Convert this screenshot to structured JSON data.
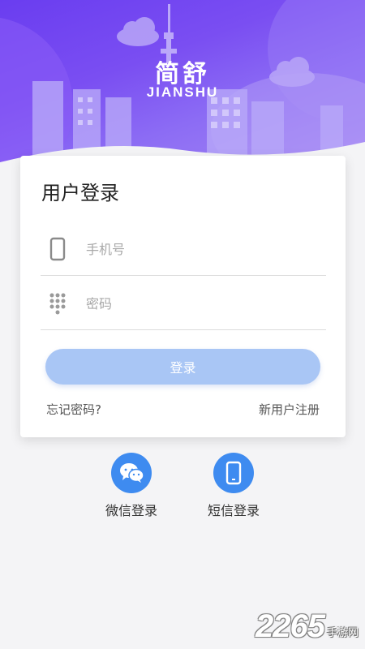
{
  "brand": {
    "title": "简舒",
    "subtitle": "JIANSHU"
  },
  "login_card": {
    "title": "用户登录",
    "phone_placeholder": "手机号",
    "password_placeholder": "密码",
    "login_button": "登录",
    "forgot_password": "忘记密码?",
    "register": "新用户注册"
  },
  "alt_logins": [
    {
      "label": "微信登录",
      "icon": "wechat-icon"
    },
    {
      "label": "短信登录",
      "icon": "mobile-phone-icon"
    }
  ],
  "watermark": {
    "number": "2265",
    "text": "手游网"
  },
  "colors": {
    "hero_gradient": [
      "#6a3df0",
      "#a98cf6"
    ],
    "accent": "#3e8bf0",
    "login_button": "#a9c6f5",
    "background": "#f4f4f6"
  }
}
